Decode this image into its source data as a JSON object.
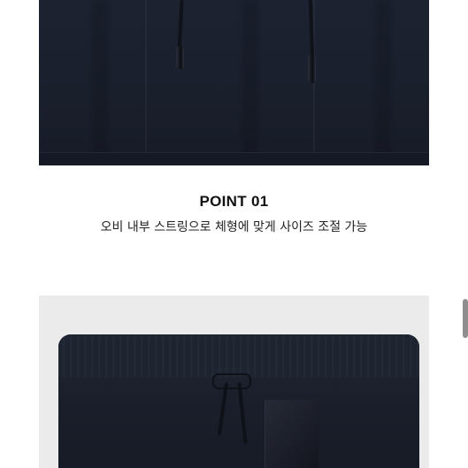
{
  "feature": {
    "title": "POINT 01",
    "description": "오비 내부 스트링으로 체형에 맞게 사이즈 조절 가능"
  },
  "images": {
    "top": "drawstring-closeup-photo",
    "bottom": "waistband-photo"
  },
  "colors": {
    "fabric": "#1a1f2c",
    "background": "#ffffff",
    "photo_backdrop": "#ebebeb"
  }
}
